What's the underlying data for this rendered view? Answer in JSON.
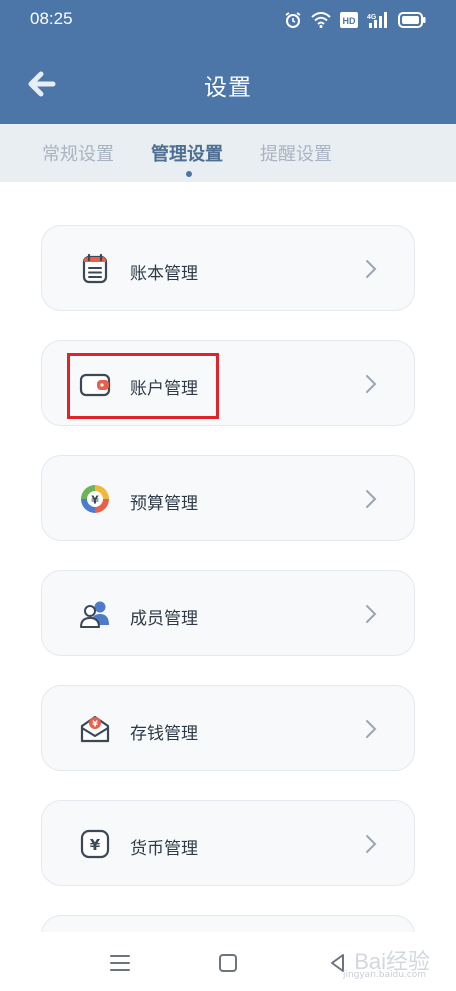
{
  "status_bar": {
    "time": "08:25",
    "icons": [
      "alarm-icon",
      "wifi-icon",
      "hd-icon",
      "4g-signal-icon",
      "battery-icon"
    ],
    "hd_label": "HD",
    "network_label": "4G"
  },
  "header": {
    "title": "设置",
    "background_color": "#4c76a7"
  },
  "tabs": [
    {
      "label": "常规设置",
      "active": false
    },
    {
      "label": "管理设置",
      "active": true
    },
    {
      "label": "提醒设置",
      "active": false
    }
  ],
  "menu": [
    {
      "label": "账本管理",
      "icon": "ledger-icon"
    },
    {
      "label": "账户管理",
      "icon": "wallet-icon",
      "highlighted": true
    },
    {
      "label": "预算管理",
      "icon": "budget-pie-icon"
    },
    {
      "label": "成员管理",
      "icon": "members-icon"
    },
    {
      "label": "存钱管理",
      "icon": "savings-envelope-icon"
    },
    {
      "label": "货币管理",
      "icon": "currency-yuan-icon"
    }
  ],
  "nav": {
    "buttons": [
      "menu-nav-icon",
      "home-nav-icon",
      "back-nav-icon"
    ]
  },
  "watermark": {
    "text": "Bai经验",
    "sub": "jingyan.baidu.com"
  },
  "colors": {
    "accent": "#4c76a7",
    "highlight": "#e0232b"
  }
}
